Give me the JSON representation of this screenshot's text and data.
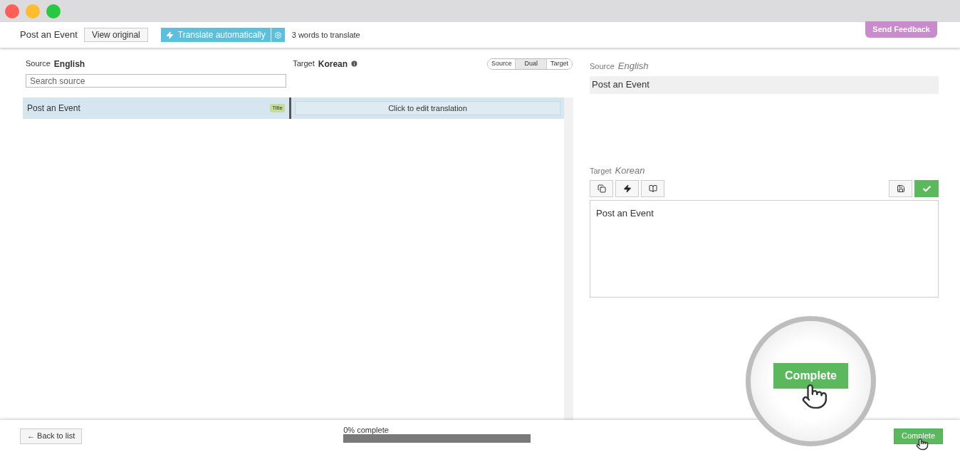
{
  "header": {
    "title": "Post an Event",
    "view_original": "View original",
    "translate_button": "Translate automatically",
    "word_count": "3 words to translate",
    "feedback": "Send Feedback"
  },
  "editor": {
    "source_label": "Source",
    "source_lang": "English",
    "target_label": "Target",
    "target_lang": "Korean",
    "search": {
      "placeholder": "Search source"
    },
    "view_modes": [
      {
        "label": "Source",
        "selected": false
      },
      {
        "label": "Dual",
        "selected": true
      },
      {
        "label": "Target",
        "selected": false
      }
    ],
    "rows": [
      {
        "source": "Post an Event",
        "tag": "Title",
        "translation": "Click to edit translation",
        "selected": true
      }
    ]
  },
  "detail": {
    "source_label": "Source",
    "source_lang": "English",
    "source_text": "Post an Event",
    "target_label": "Target",
    "target_lang": "Korean",
    "target_text": "Post an Event"
  },
  "magnifier": {
    "button": "Complete"
  },
  "footer": {
    "back": "← Back to list",
    "progress_text": "0% complete",
    "level": 0,
    "complete": "Complete"
  }
}
